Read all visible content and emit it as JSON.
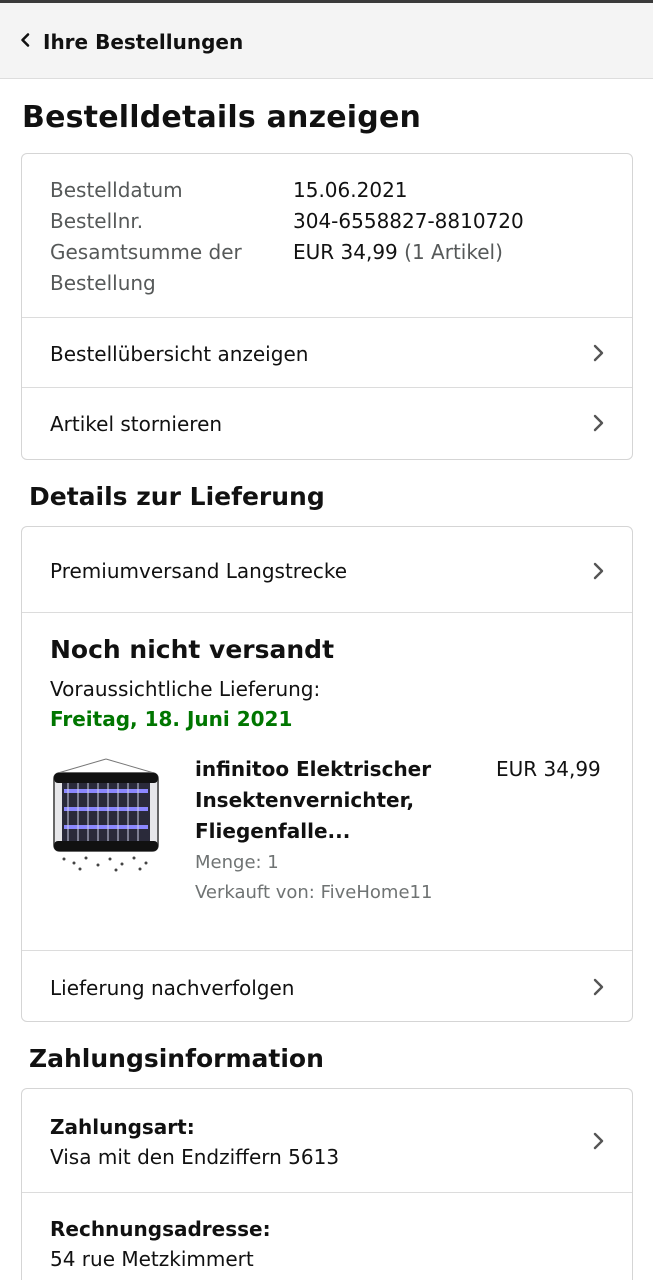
{
  "header": {
    "back_label": "Ihre Bestellungen"
  },
  "page_title": "Bestelldetails anzeigen",
  "order": {
    "date_label": "Bestelldatum",
    "date_value": "15.06.2021",
    "number_label": "Bestellnr.",
    "number_value": "304-6558827-8810720",
    "total_label_line1": "Gesamtsumme der",
    "total_label_line2": "Bestellung",
    "total_value": "EUR 34,99",
    "total_count": "(1 Artikel)",
    "link_overview": "Bestellübersicht anzeigen",
    "link_cancel": "Artikel stornieren"
  },
  "delivery": {
    "section_title": "Details zur Lieferung",
    "shipping_method": "Premiumversand Langstrecke",
    "status": "Noch nicht versandt",
    "expected_label": "Voraussichtliche Lieferung:",
    "expected_date": "Freitag, 18. Juni 2021",
    "item": {
      "title_line1": "infinitoo Elektrischer",
      "title_line2": "Insektenvernichter,",
      "title_line3": "Fliegenfalle...",
      "price": "EUR 34,99",
      "quantity": "Menge: 1",
      "seller": "Verkauft von: FiveHome11"
    },
    "track_link": "Lieferung nachverfolgen"
  },
  "payment": {
    "section_title": "Zahlungsinformation",
    "method_label": "Zahlungsart:",
    "method_value": "Visa mit den Endziffern 5613",
    "billing_label": "Rechnungsadresse:",
    "billing_line1": "54 rue Metzkimmert"
  },
  "colors": {
    "accent_green": "#007600",
    "header_bg": "#f4f4f4",
    "border": "#d5d5d5"
  }
}
